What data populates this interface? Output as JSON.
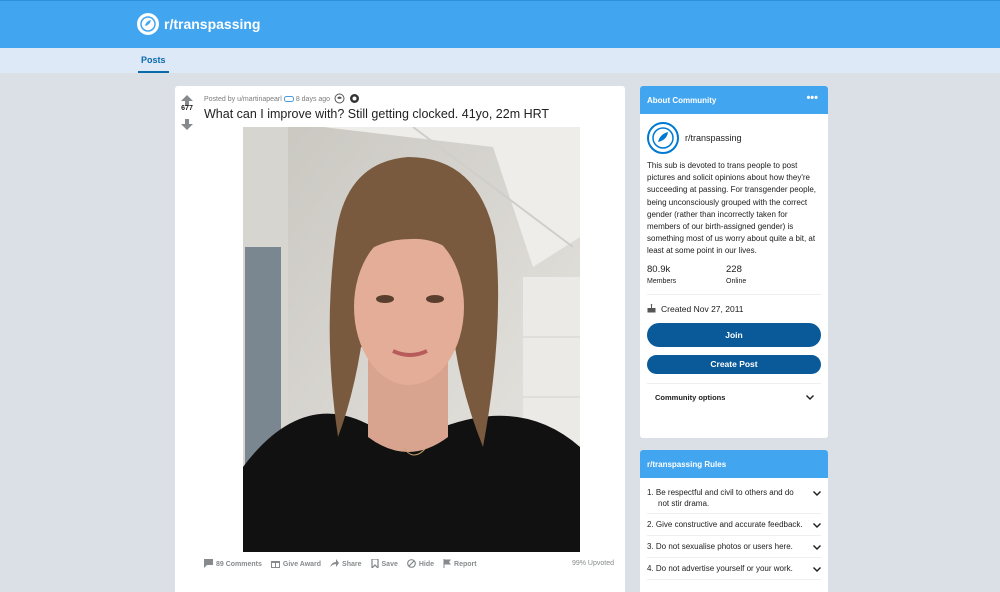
{
  "subreddit": {
    "name": "r/transpassing"
  },
  "nav": {
    "tabs": [
      {
        "label": "Posts"
      }
    ]
  },
  "post": {
    "votes": "677",
    "meta_prefix": "Posted by u/martinapearl",
    "time": "8 days ago",
    "title": "What can I improve with? Still getting clocked. 41yo, 22m HRT",
    "comments": "89 Comments",
    "give_award": "Give Award",
    "share": "Share",
    "save": "Save",
    "hide": "Hide",
    "report": "Report",
    "upvoted": "99% Upvoted"
  },
  "about": {
    "header": "About Community",
    "name": "r/transpassing",
    "description": "This sub is devoted to trans people to post pictures and solicit opinions about how they're succeeding at passing. For transgender people, being unconsciously grouped with the correct gender (rather than incorrectly taken for members of our birth-assigned gender) is something most of us worry about quite a bit, at least at some point in our lives.",
    "members_count": "80.9k",
    "members_label": "Members",
    "online_count": "228",
    "online_label": "Online",
    "created": "Created Nov 27, 2011",
    "join": "Join",
    "create_post": "Create Post",
    "options": "Community options"
  },
  "rules": {
    "header": "r/transpassing Rules",
    "items": [
      "1. Be respectful and civil to others and do not stir drama.",
      "2. Give constructive and accurate feedback.",
      "3. Do not sexualise photos or users here.",
      "4. Do not advertise yourself or your work."
    ]
  },
  "colors": {
    "brand": "#42a5f0",
    "button": "#0a5a9a",
    "background": "#dae0e6"
  },
  "icons": [
    "subreddit-icon",
    "upvote-icon",
    "downvote-icon",
    "comment-icon",
    "gift-icon",
    "share-icon",
    "bookmark-icon",
    "hide-icon",
    "flag-icon",
    "cake-icon",
    "chevron-down-icon"
  ]
}
